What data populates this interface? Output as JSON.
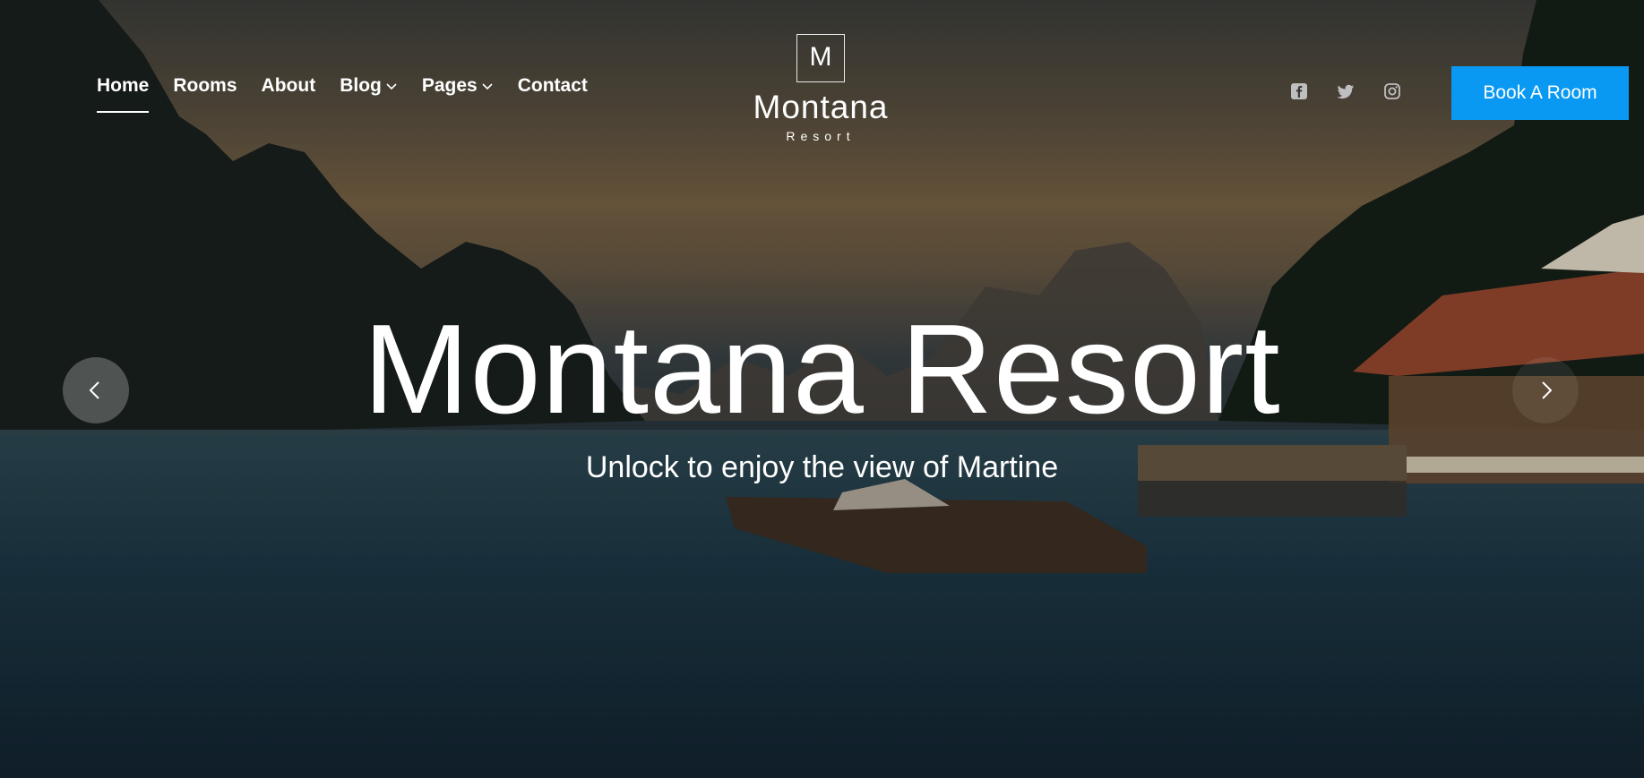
{
  "nav": {
    "items": [
      {
        "label": "Home",
        "active": true
      },
      {
        "label": "Rooms"
      },
      {
        "label": "About"
      },
      {
        "label": "Blog",
        "dropdown": true
      },
      {
        "label": "Pages",
        "dropdown": true
      },
      {
        "label": "Contact"
      }
    ]
  },
  "logo": {
    "mark": "M",
    "name": "Montana",
    "tagline": "Resort"
  },
  "social": {
    "icons": [
      "facebook-icon",
      "twitter-icon",
      "instagram-icon"
    ]
  },
  "cta": {
    "book_label": "Book A Room",
    "color": "#0a99f2"
  },
  "hero": {
    "title": "Montana Resort",
    "subtitle": "Unlock to enjoy the view of Martine"
  },
  "slider": {
    "prev_icon": "chevron-left-icon",
    "next_icon": "chevron-right-icon"
  }
}
